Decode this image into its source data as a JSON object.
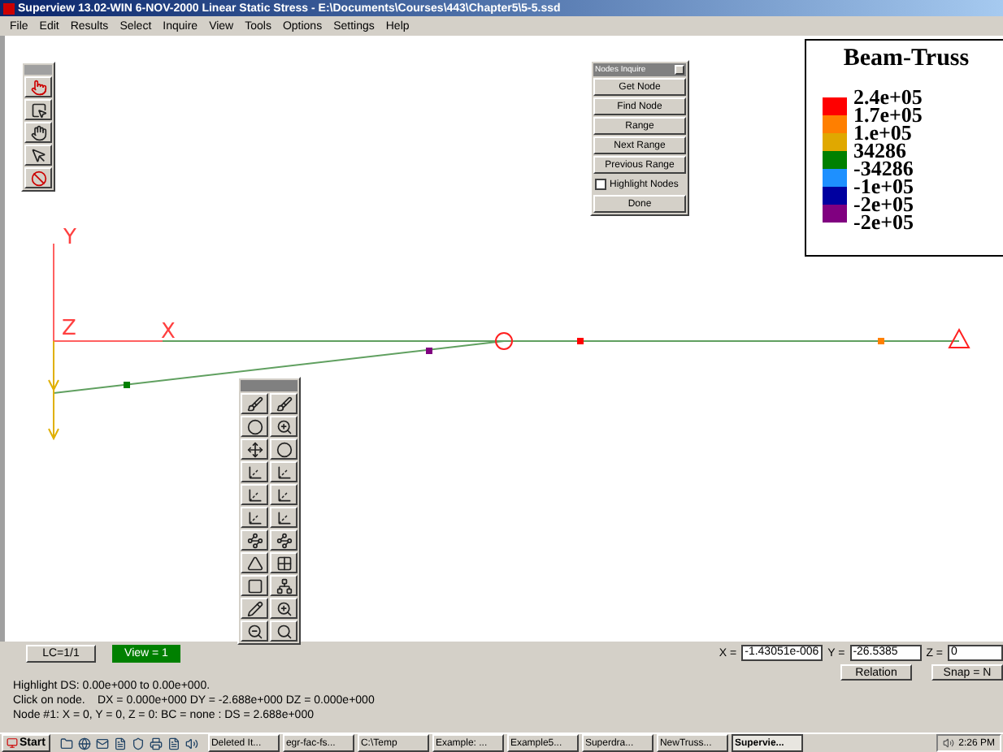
{
  "window": {
    "title": "Superview 13.02-WIN 6-NOV-2000 Linear Static Stress - E:\\Documents\\Courses\\443\\Chapter5\\5-5.ssd"
  },
  "menu": [
    "File",
    "Edit",
    "Results",
    "Select",
    "Inquire",
    "View",
    "Tools",
    "Options",
    "Settings",
    "Help"
  ],
  "model": {
    "axis_labels": [
      "Y",
      "Z",
      "X"
    ],
    "nodes": [
      {
        "color": "#008000"
      },
      {
        "color": "#800080"
      },
      {
        "color": "#ff0000"
      },
      {
        "color": "#ff8000"
      }
    ]
  },
  "node_inquire": {
    "title": "Nodes Inquire",
    "buttons": [
      "Get Node",
      "Find Node",
      "Range",
      "Next Range",
      "Previous Range"
    ],
    "highlight": {
      "label": "Highlight Nodes",
      "checked": false
    },
    "done": "Done"
  },
  "legend": {
    "title": "Beam-Truss",
    "bands": [
      {
        "color": "#ff0000"
      },
      {
        "color": "#ff7f00"
      },
      {
        "color": "#e0a800"
      },
      {
        "color": "#008000"
      },
      {
        "color": "#1e90ff"
      },
      {
        "color": "#0000a0"
      },
      {
        "color": "#800080"
      }
    ],
    "labels": [
      "2.4e+05",
      "1.7e+05",
      "1.e+05",
      "34286",
      "-34286",
      "-1e+05",
      "-2e+05",
      "-2e+05"
    ]
  },
  "bottom": {
    "lc_button": "LC=1/1",
    "view_button": {
      "label": "View = 1",
      "selected": true
    },
    "status": [
      "Highlight DS: 0.00e+000 to 0.00e+000.",
      "Click on node.",
      "DX = 0.000e+000 DY = -2.688e+000 DZ = 0.000e+000",
      "Node #1: X = 0, Y = 0, Z = 0: BC = none : DS = 2.688e+000"
    ],
    "coords": [
      {
        "label": "X =",
        "value": "-1.43051e-006"
      },
      {
        "label": "Y =",
        "value": "-26.5385"
      },
      {
        "label": "Z =",
        "value": "0"
      }
    ],
    "buttons": [
      "Relation",
      "Snap = N"
    ]
  },
  "taskbar": {
    "start": "Start",
    "tasks": [
      {
        "label": "Deleted It...",
        "selected": false
      },
      {
        "label": "egr-fac-fs...",
        "selected": false
      },
      {
        "label": "C:\\Temp",
        "selected": false
      },
      {
        "label": "Example: ...",
        "selected": false
      },
      {
        "label": "Example5...",
        "selected": false
      },
      {
        "label": "Superdra...",
        "selected": false
      },
      {
        "label": "NewTruss...",
        "selected": false
      },
      {
        "label": "Supervie...",
        "selected": true
      }
    ],
    "clock": "2:26 PM"
  }
}
